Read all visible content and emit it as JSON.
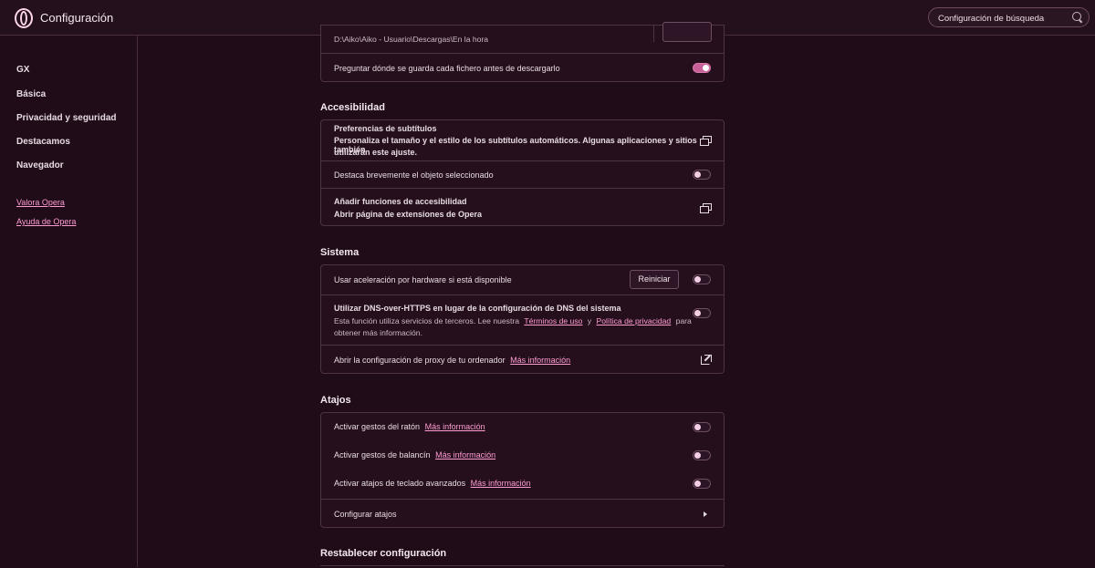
{
  "header": {
    "title": "Configuración",
    "search_placeholder": "Configuración de búsqueda"
  },
  "sidebar": {
    "items": [
      {
        "label": "GX"
      },
      {
        "label": "Básica"
      },
      {
        "label": "Privacidad y seguridad"
      },
      {
        "label": "Destacamos"
      },
      {
        "label": "Navegador"
      }
    ],
    "links": [
      {
        "label": "Valora Opera"
      },
      {
        "label": "Ayuda de Opera"
      }
    ]
  },
  "downloads": {
    "path": "D:\\Aiko\\Aiko - Usuario\\Descargas\\En la hora",
    "ask_label": "Preguntar dónde se guarda cada fichero antes de descargarlo",
    "ask_enabled": true
  },
  "accessibility": {
    "title": "Accesibilidad",
    "captions_title": "Preferencias de subtítulos",
    "captions_desc_1": "Personaliza el tamaño y el estilo de los subtítulos automáticos. Algunas aplicaciones y sitios también",
    "captions_desc_2": "utilizarán este ajuste.",
    "highlight_label": "Destaca brevemente el objeto seleccionado",
    "highlight_enabled": false,
    "add_features_title": "Añadir funciones de accesibilidad",
    "add_features_desc": "Abrir página de extensiones de Opera"
  },
  "system": {
    "title": "Sistema",
    "hw_accel_label": "Usar aceleración por hardware si está disponible",
    "restart_label": "Reiniciar",
    "hw_accel_enabled": false,
    "doh_title": "Utilizar DNS-over-HTTPS en lugar de la configuración de DNS del sistema",
    "doh_desc_a": "Esta función utiliza servicios de terceros. Lee nuestra",
    "doh_terms": "Términos de uso",
    "doh_and": "y",
    "doh_privacy": "Política de privacidad",
    "doh_desc_b": "para",
    "doh_desc_c": "obtener más información.",
    "doh_enabled": false,
    "proxy_label": "Abrir la configuración de proxy de tu ordenador",
    "proxy_more": "Más información"
  },
  "shortcuts": {
    "title": "Atajos",
    "mouse_gestures": "Activar gestos del ratón",
    "mouse_more": "Más información",
    "rocker_gestures": "Activar gestos de balancín",
    "rocker_more": "Más información",
    "keyboard_shortcuts": "Activar atajos de teclado avanzados",
    "keyboard_more": "Más información",
    "configure": "Configurar atajos"
  },
  "reset": {
    "title": "Restablecer configuración"
  },
  "colors": {
    "background": "#200b19",
    "accent": "#ff9dd1",
    "toggle_on": "#c95f99"
  }
}
